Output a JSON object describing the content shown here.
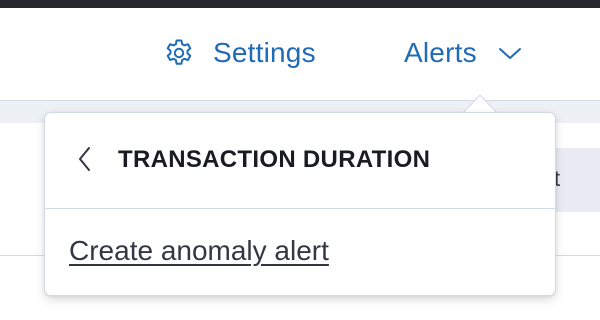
{
  "header": {
    "settings_label": "Settings",
    "settings_icon": "gear-icon",
    "alerts_label": "Alerts",
    "alerts_icon": "chevron-down-icon",
    "link_color": "#1f6bb6"
  },
  "background": {
    "partial_text": "t"
  },
  "popover": {
    "back_icon": "chevron-left-icon",
    "title": "TRANSACTION DURATION",
    "items": [
      {
        "label": "Create anomaly alert"
      }
    ]
  }
}
